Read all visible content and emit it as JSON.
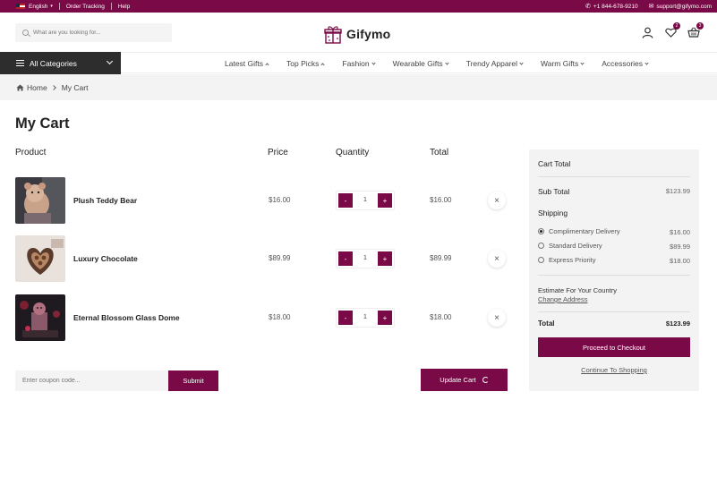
{
  "topbar": {
    "language": "English",
    "order_tracking": "Order Tracking",
    "help": "Help",
    "phone": "+1 844-678-9210",
    "email": "support@gifymo.com"
  },
  "header": {
    "search_placeholder": "What are you looking for...",
    "logo_text": "Gifymo",
    "wishlist_count": "2",
    "cart_count": "3"
  },
  "nav": {
    "all_categories": "All Categories",
    "items": [
      {
        "label": "Latest Gifts"
      },
      {
        "label": "Top Picks"
      },
      {
        "label": "Fashion"
      },
      {
        "label": "Wearable Gifts"
      },
      {
        "label": "Trendy Apparel"
      },
      {
        "label": "Warm Gifts"
      },
      {
        "label": "Accessories"
      }
    ]
  },
  "breadcrumb": {
    "home": "Home",
    "current": "My Cart"
  },
  "page_title": "My Cart",
  "table": {
    "headers": {
      "product": "Product",
      "price": "Price",
      "quantity": "Quantity",
      "total": "Total"
    },
    "rows": [
      {
        "name": "Plush Teddy Bear",
        "price": "$16.00",
        "qty": "1",
        "total": "$16.00",
        "minus": "-",
        "plus": "+",
        "remove": "×"
      },
      {
        "name": "Luxury Chocolate",
        "price": "$89.99",
        "qty": "1",
        "total": "$89.99",
        "minus": "-",
        "plus": "+",
        "remove": "×"
      },
      {
        "name": "Eternal Blossom Glass Dome",
        "price": "$18.00",
        "qty": "1",
        "total": "$18.00",
        "minus": "-",
        "plus": "+",
        "remove": "×"
      }
    ]
  },
  "coupon": {
    "placeholder": "Enter coupon code...",
    "submit": "Submit"
  },
  "update_cart": "Update Cart",
  "summary": {
    "title": "Cart Total",
    "subtotal_label": "Sub Total",
    "subtotal_value": "$123.99",
    "shipping_label": "Shipping",
    "options": [
      {
        "label": "Complimentary Delivery",
        "value": "$16.00"
      },
      {
        "label": "Standard Delivery",
        "value": "$89.99"
      },
      {
        "label": "Express Priority",
        "value": "$18.00"
      }
    ],
    "estimate_label": "Estimate For Your Country",
    "change_address": "Change Address",
    "total_label": "Total",
    "total_value": "$123.99",
    "checkout": "Proceed to Checkout",
    "continue": "Continue To Shopping"
  },
  "colors": {
    "brand": "#7a0a47",
    "dark": "#2d2d2d"
  }
}
